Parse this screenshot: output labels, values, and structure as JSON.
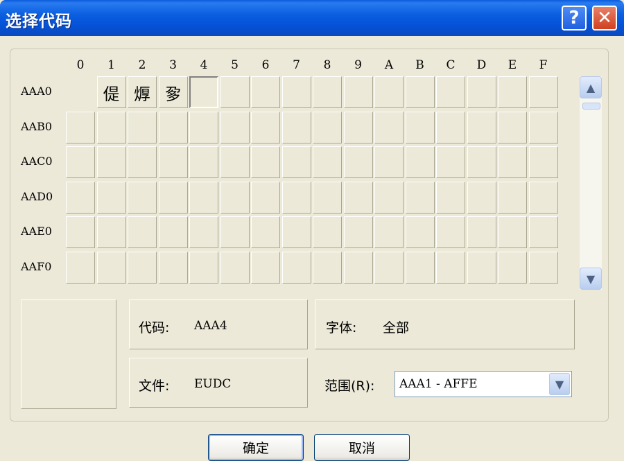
{
  "window": {
    "title": "选择代码",
    "help": "?",
    "close": "✕"
  },
  "grid": {
    "columns": [
      "0",
      "1",
      "2",
      "3",
      "4",
      "5",
      "6",
      "7",
      "8",
      "9",
      "A",
      "B",
      "C",
      "D",
      "E",
      "F"
    ],
    "rows": [
      "AAA0",
      "AAB0",
      "AAC0",
      "AAD0",
      "AAE0",
      "AAF0"
    ],
    "chars": {
      "AAA1": "偍",
      "AAA2": "㷞",
      "AAA3": "㚉"
    },
    "selected": "AAA4"
  },
  "scrollbar": {
    "up": "▲",
    "down": "▼"
  },
  "info": {
    "code_label": "代码:",
    "code_value": "AAA4",
    "font_label": "字体:",
    "font_value": "全部",
    "file_label": "文件:",
    "file_value": "EUDC",
    "range_label": "范围(R):",
    "range_value": "AAA1 - AFFE"
  },
  "buttons": {
    "ok": "确定",
    "cancel": "取消"
  }
}
